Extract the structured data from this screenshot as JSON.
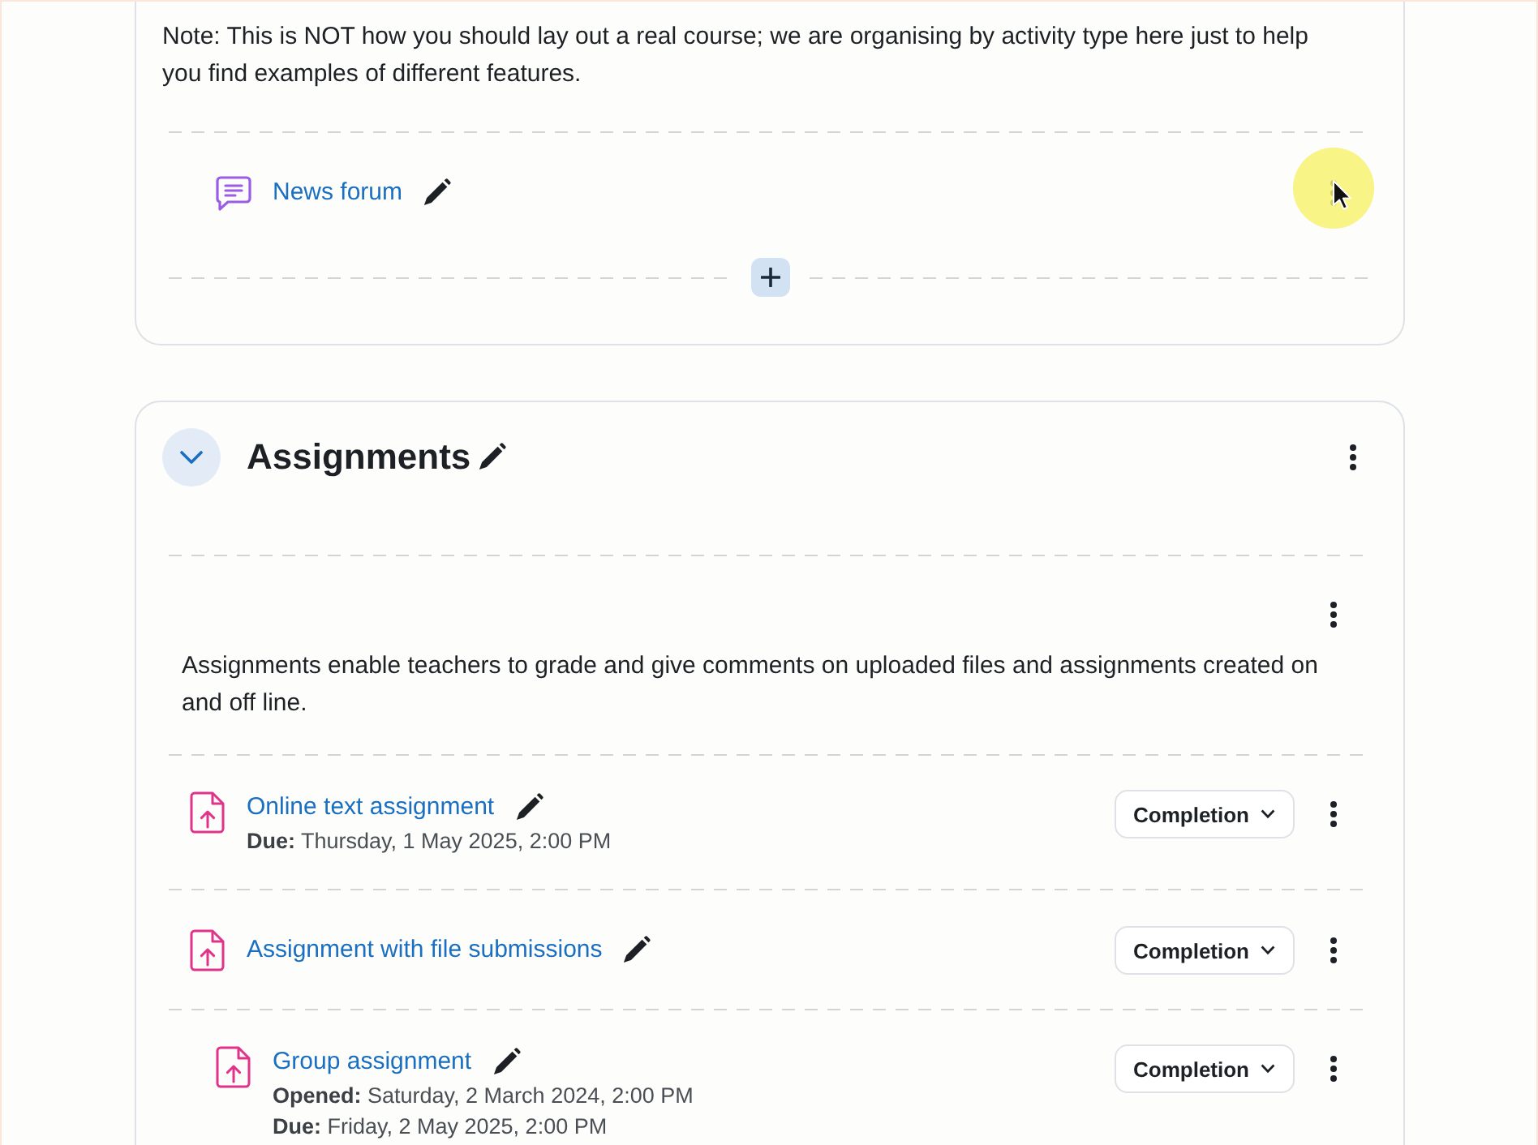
{
  "intro_section": {
    "summary": "Note: This is NOT how you should lay out a real course; we are organising by activity type here just to help you find examples of different features.",
    "activities": [
      {
        "kind": "forum",
        "title": "News forum"
      }
    ]
  },
  "section": {
    "title": "Assignments",
    "expanded": true,
    "summary": "Assignments enable teachers to grade and give comments on uploaded files and assignments created on and off line.",
    "activities": [
      {
        "kind": "assignment",
        "title": "Online text assignment",
        "dates": [
          "**Due:** Thursday, 1 May 2025, 2:00 PM"
        ],
        "completion": "Completion"
      },
      {
        "kind": "assignment",
        "title": "Assignment with file submissions",
        "completion": "Completion",
        "children": [
          {
            "kind": "assignment",
            "title": "Group assignment",
            "dates": [
              "**Opened:** Saturday, 2 March 2024, 2:00 PM",
              "**Due:** Friday, 2 May 2025, 2:00 PM"
            ],
            "completion": "Completion"
          }
        ]
      }
    ]
  }
}
